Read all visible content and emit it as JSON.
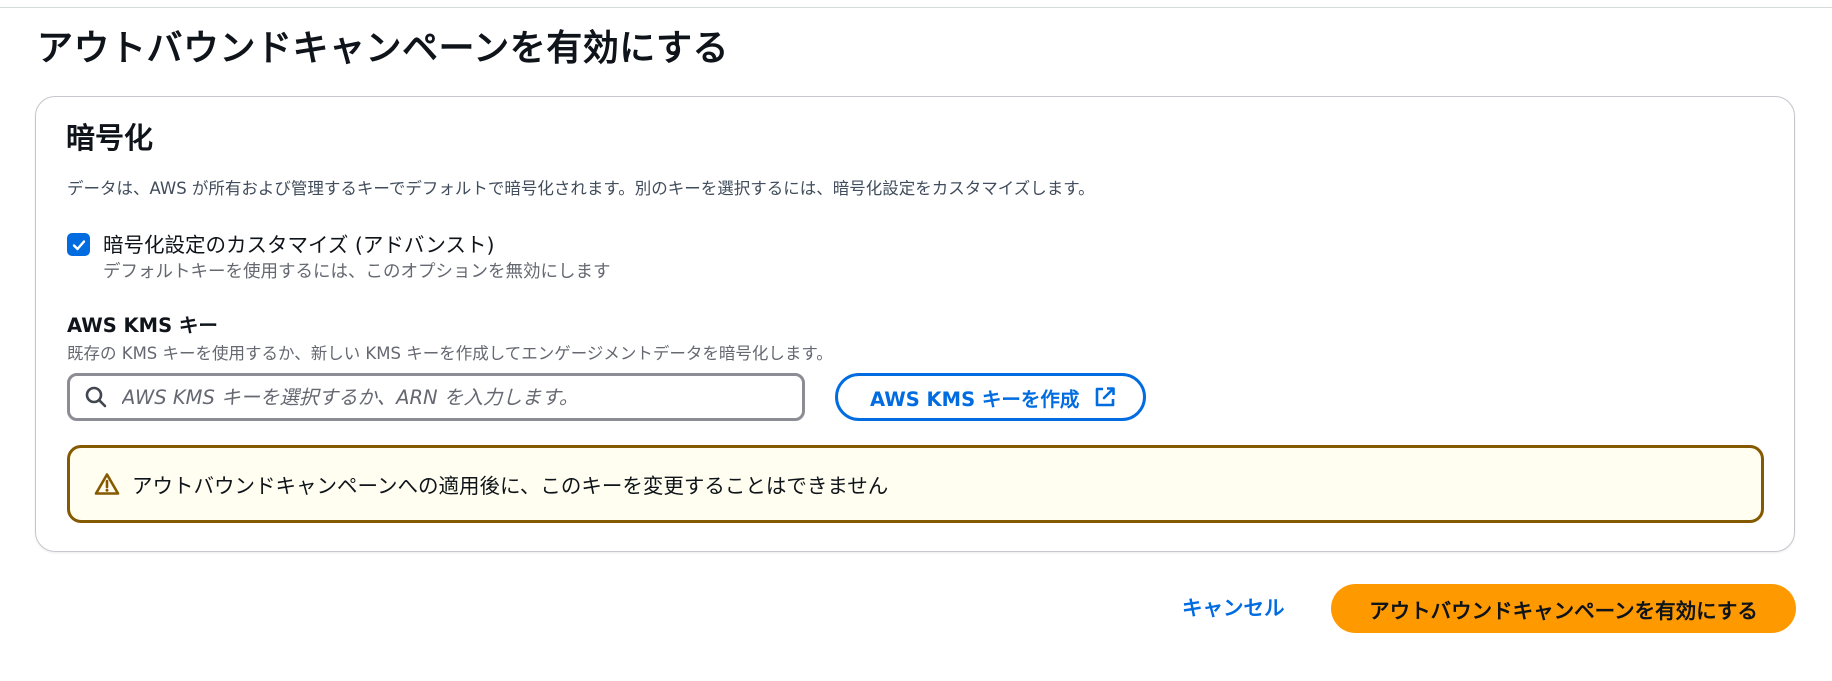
{
  "page": {
    "title": "アウトバウンドキャンペーンを有効にする"
  },
  "encryption": {
    "title": "暗号化",
    "description": "データは、AWS が所有および管理するキーでデフォルトで暗号化されます。別のキーを選択するには、暗号化設定をカスタマイズします。",
    "customize_checkbox": {
      "label": "暗号化設定のカスタマイズ (アドバンスト)",
      "description": "デフォルトキーを使用するには、このオプションを無効にします",
      "checked": true
    },
    "kms_key": {
      "label": "AWS KMS キー",
      "description": "既存の KMS キーを使用するか、新しい KMS キーを作成してエンゲージメントデータを暗号化します。",
      "search_placeholder": "AWS KMS キーを選択するか、ARN を入力します。",
      "search_value": "",
      "search_icon": "search-icon",
      "create_button_label": "AWS KMS キーを作成",
      "create_button_icon": "external-link-icon"
    },
    "warning": {
      "icon": "warning-icon",
      "text": "アウトバウンドキャンペーンへの適用後に、このキーを変更することはできません"
    }
  },
  "actions": {
    "cancel_label": "キャンセル",
    "submit_label": "アウトバウンドキャンペーンを有効にする"
  },
  "colors": {
    "accent": "#006ce0",
    "primary_button": "#ff9900",
    "warning_border": "#855900",
    "warning_background": "#fffef0"
  }
}
